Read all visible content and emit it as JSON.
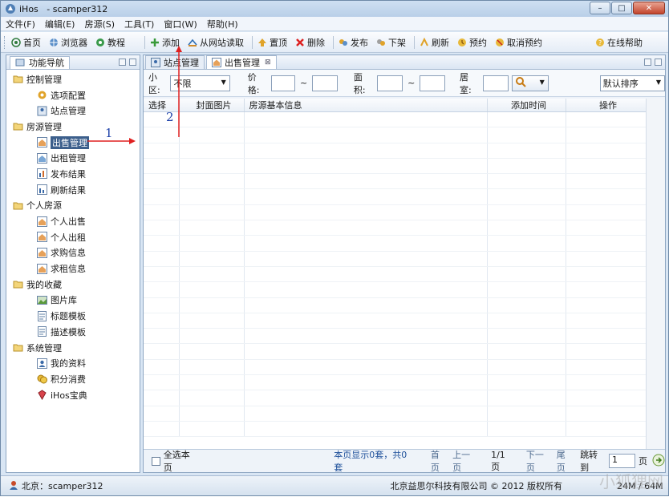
{
  "window": {
    "app_name": "iHos",
    "title_suffix": "- scamper312",
    "controls": [
      "–",
      "□",
      "✕"
    ]
  },
  "menu": [
    "文件(F)",
    "编辑(E)",
    "房源(S)",
    "工具(T)",
    "窗口(W)",
    "帮助(H)"
  ],
  "toolbar": {
    "nav": [
      {
        "label": "首页",
        "icon": "home-icon"
      },
      {
        "label": "浏览器",
        "icon": "browser-icon"
      },
      {
        "label": "教程",
        "icon": "tutorial-icon"
      }
    ],
    "actions": [
      {
        "label": "添加",
        "icon": "add-icon"
      },
      {
        "label": "从网站读取",
        "icon": "import-icon"
      },
      {
        "label": "置顶",
        "icon": "pin-top-icon"
      },
      {
        "label": "删除",
        "icon": "delete-icon"
      },
      {
        "label": "发布",
        "icon": "publish-icon"
      },
      {
        "label": "下架",
        "icon": "unpublish-icon"
      },
      {
        "label": "刷新",
        "icon": "refresh-icon"
      },
      {
        "label": "预约",
        "icon": "schedule-icon"
      },
      {
        "label": "取消预约",
        "icon": "cancel-schedule-icon"
      }
    ],
    "help_label": "在线帮助"
  },
  "nav_panel": {
    "title": "功能导航",
    "groups": [
      {
        "label": "控制管理",
        "items": [
          "选项配置",
          "站点管理"
        ]
      },
      {
        "label": "房源管理",
        "items": [
          "出售管理",
          "出租管理",
          "发布结果",
          "刷新结果"
        ]
      },
      {
        "label": "个人房源",
        "items": [
          "个人出售",
          "个人出租",
          "求购信息",
          "求租信息"
        ]
      },
      {
        "label": "我的收藏",
        "items": [
          "图片库",
          "标题模板",
          "描述模板"
        ]
      },
      {
        "label": "系统管理",
        "items": [
          "我的资料",
          "积分消费",
          "iHos宝典"
        ]
      }
    ],
    "selected": "出售管理"
  },
  "tabs": [
    {
      "label": "站点管理",
      "active": false
    },
    {
      "label": "出售管理",
      "active": true
    }
  ],
  "filter": {
    "district_label": "小区:",
    "district_value": "不限",
    "price_label": "价格:",
    "area_label": "面积:",
    "rooms_label": "居室:",
    "range_sep": "~",
    "sort_value": "默认排序"
  },
  "grid": {
    "columns": [
      "选择",
      "封面图片",
      "房源基本信息",
      "添加时间",
      "操作"
    ],
    "rows": []
  },
  "pager": {
    "select_all": "全选本页",
    "summary": "本页显示0套，共0套",
    "first": "首页",
    "prev": "上一页",
    "page_info": "1/1页",
    "next": "下一页",
    "last": "尾页",
    "goto_label": "跳转到",
    "goto_value": "1",
    "page_unit": "页"
  },
  "status": {
    "user": "北京：scamper312",
    "copyright": "北京益思尔科技有限公司 © 2012 版权所有",
    "memory": "24M / 64M"
  },
  "annotations": {
    "arrow1": "1",
    "arrow2": "2"
  },
  "watermark": "小狐狸网"
}
